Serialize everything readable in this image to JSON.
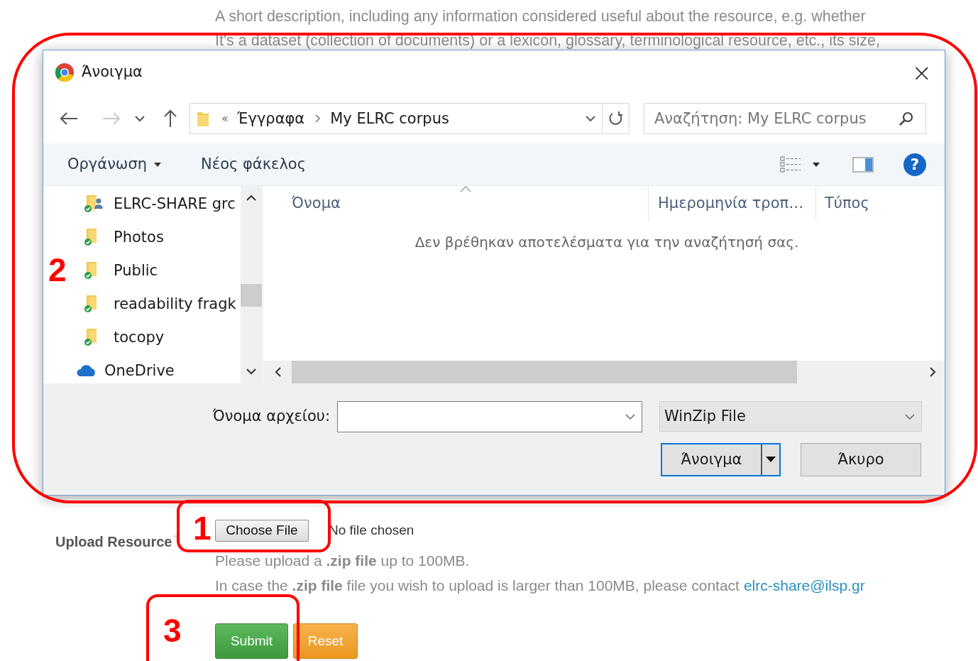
{
  "page": {
    "description": [
      "A short description, including any information considered useful about the resource, e.g. whether",
      "It's a dataset (collection of documents) or a lexicon, glossary, terminological resource, etc., its size,"
    ],
    "upload_label": "Upload Resource",
    "required_mark": "*",
    "choose_button": "Choose File",
    "file_status": "No file chosen",
    "help": [
      "Please upload a **.zip file** up to 100MB.",
      "In case the **.zip file** file you wish to upload is larger than 100MB, please contact"
    ],
    "contact_link": "elrc-share@ilsp.gr",
    "buttons": [
      {
        "label": "Submit",
        "kind": "submit"
      },
      {
        "label": "Reset",
        "kind": "reset"
      }
    ]
  },
  "dialog": {
    "title": "Άνοιγμα",
    "close": "×",
    "nav_buttons": [
      {
        "kind": "back",
        "disabled": false
      },
      {
        "kind": "forward",
        "disabled": true
      },
      {
        "kind": "recent",
        "disabled": false
      },
      {
        "kind": "up",
        "disabled": false
      }
    ],
    "breadcrumb": {
      "overflow": "«",
      "items": [
        "Έγγραφα",
        "My ELRC corpus"
      ]
    },
    "search": {
      "placeholder": "Αναζήτηση: My ELRC corpus"
    },
    "toolbar": {
      "organize": "Οργάνωση",
      "new_folder": "Νέος φάκελος",
      "help": "?"
    },
    "nav_items": [
      {
        "label": "ELRC-SHARE grc",
        "kind": "shared"
      },
      {
        "label": "Photos",
        "kind": "folder"
      },
      {
        "label": "Public",
        "kind": "folder"
      },
      {
        "label": "readability fragk",
        "kind": "folder"
      },
      {
        "label": "tocopy",
        "kind": "folder"
      },
      {
        "label": "OneDrive",
        "kind": "cloud"
      }
    ],
    "columns": [
      "Όνομα",
      "Ημερομηνία τροπ…",
      "Τύπος"
    ],
    "empty_message": "Δεν βρέθηκαν αποτελέσματα για την αναζήτησή σας.",
    "file_name": {
      "label": "Όνομα αρχείου:"
    },
    "file_type": "WinZip File",
    "buttons": [
      {
        "label": "Άνοιγμα",
        "kind": "primary"
      },
      {
        "label": "Άκυρο",
        "kind": "cancel"
      }
    ]
  },
  "annotations": [
    {
      "label": "2"
    },
    {
      "label": "1"
    },
    {
      "label": "3"
    }
  ]
}
